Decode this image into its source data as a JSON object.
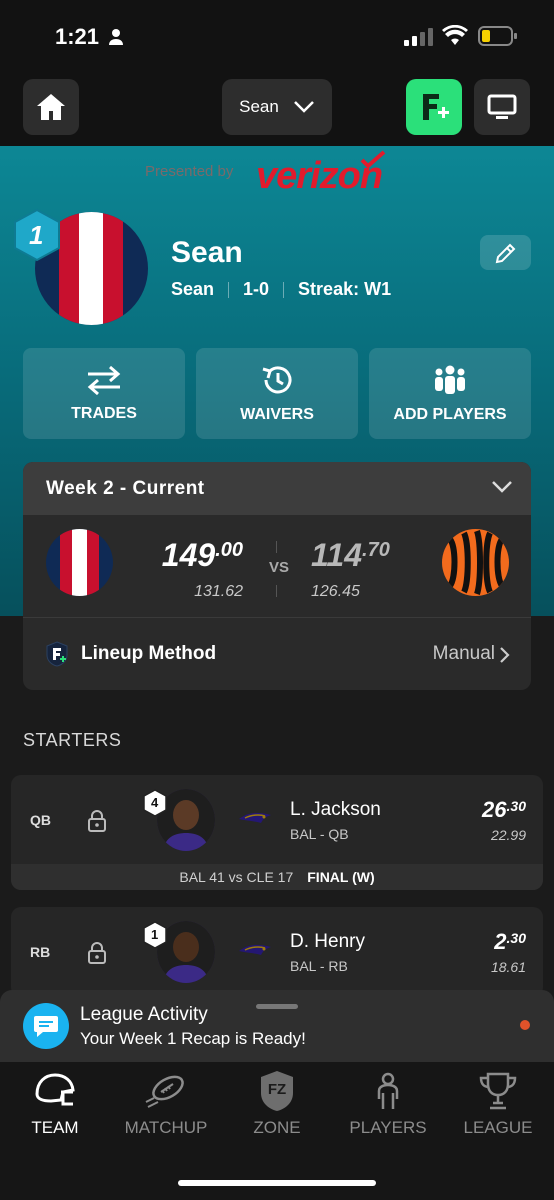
{
  "status": {
    "time": "1:21"
  },
  "topnav": {
    "team_selector": "Sean"
  },
  "sponsor": {
    "presented_by": "Presented by",
    "brand": "verizon"
  },
  "team": {
    "rank": "1",
    "name": "Sean",
    "owner": "Sean",
    "record": "1-0",
    "streak": "Streak: W1"
  },
  "actions": [
    {
      "label": "TRADES",
      "icon": "swap-arrows-icon"
    },
    {
      "label": "WAIVERS",
      "icon": "clock-refresh-icon"
    },
    {
      "label": "ADD PLAYERS",
      "icon": "group-icon"
    }
  ],
  "matchup": {
    "week_label": "Week 2 - Current",
    "home": {
      "score_int": "149",
      "score_dec": ".00",
      "projected": "131.62"
    },
    "vs": "VS",
    "away": {
      "score_int": "114",
      "score_dec": ".70",
      "projected": "126.45"
    },
    "lineup_title": "Lineup Method",
    "lineup_value": "Manual"
  },
  "starters": {
    "title": "STARTERS",
    "players": [
      {
        "pos": "QB",
        "rank": "4",
        "name": "L. Jackson",
        "meta": "BAL - QB",
        "pts_int": "26",
        "pts_dec": ".30",
        "proj": "22.99",
        "game": "BAL 41 vs CLE 17",
        "result": "FINAL (W)"
      },
      {
        "pos": "RB",
        "rank": "1",
        "name": "D. Henry",
        "meta": "BAL - RB",
        "pts_int": "2",
        "pts_dec": ".30",
        "proj": "18.61"
      }
    ]
  },
  "notification": {
    "title": "League Activity",
    "subtitle": "Your Week 1 Recap is Ready!"
  },
  "tabs": [
    {
      "label": "TEAM",
      "icon": "helmet-icon"
    },
    {
      "label": "MATCHUP",
      "icon": "football-icon"
    },
    {
      "label": "ZONE",
      "icon": "fz-shield-icon",
      "badge": "FZ"
    },
    {
      "label": "PLAYERS",
      "icon": "person-icon"
    },
    {
      "label": "LEAGUE",
      "icon": "trophy-icon"
    }
  ],
  "colors": {
    "accent_green": "#2be07a",
    "teal": "#0d8795",
    "verizon_red": "#e21b2c",
    "notif_blue": "#1ab3f0"
  }
}
